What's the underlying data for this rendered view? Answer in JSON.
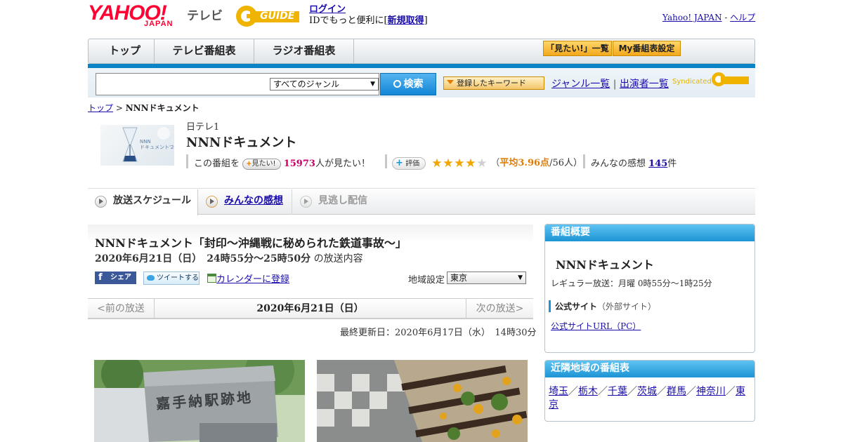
{
  "header": {
    "logo_text": "YAHOO!",
    "logo_sub": "JAPAN",
    "tv_label": "テレビ",
    "gguide_text": "GUIDE",
    "login_link": "ログイン",
    "login_desc": "IDでもっと便利に[",
    "register_link": "新規取得",
    "login_close": "]",
    "yj_link": "Yahoo! JAPAN",
    "sep": " - ",
    "help_link": "ヘルプ"
  },
  "nav": {
    "tabs": [
      "トップ",
      "テレビ番組表",
      "ラジオ番組表"
    ],
    "mitai_list": "「見たい!」一覧",
    "my_bangumi": "My番組表設定"
  },
  "search": {
    "genre_select": "すべてのジャンル",
    "button": "検索",
    "keyword_btn": "登録したキーワード",
    "genre_list": "ジャンル一覧",
    "divider": "|",
    "cast_list": "出演者一覧",
    "syndicated": "Syndicated"
  },
  "breadcrumb": {
    "top": "トップ",
    "sep": " > ",
    "current": "NNNドキュメント"
  },
  "program": {
    "thumb_text": "NNN\nドキュメント'20",
    "channel": "日テレ1",
    "title": "NNNドキュメント",
    "mitai_prefix": "この番組を",
    "mitai_btn": "見たい!",
    "mitai_count": "15973",
    "mitai_suffix": "人が見たい！",
    "rating_btn": "評価",
    "rating_avg_prefix": "（",
    "rating_avg": "平均3.96点",
    "rating_avg_suffix": "/56人）",
    "rating_value": 3.96,
    "impressions_label": "みんなの感想",
    "impressions_count": "145",
    "impressions_suffix": "件"
  },
  "schedule_tabs": [
    "放送スケジュール",
    "みんなの感想",
    "見逃し配信"
  ],
  "episode": {
    "title": "NNNドキュメント「封印～沖縄戦に秘められた鉄道事故～」",
    "date": "2020年6月21日（日）　24時55分～25時50分",
    "date_suffix": "の放送内容",
    "share_btn": "シェア",
    "tweet_btn": "ツイートする",
    "calendar_link": "カレンダーに登録",
    "region_label": "地域設定",
    "region_value": "東京",
    "prev": "<前の放送",
    "next": "次の放送>",
    "pager_date": "2020年6月21日（日）",
    "updated": "最終更新日：2020年6月17日（水）　14時30分",
    "photo1_inscription": "嘉手納駅跡地"
  },
  "sidebar": {
    "overview_head": "番組概要",
    "name": "NNNドキュメント",
    "regular": "レギュラー放送：月曜 0時55分～1時25分",
    "official_site": "公式サイト",
    "official_site_note": "（外部サイト）",
    "official_url": "公式サイトURL（PC）",
    "nearby_head": "近隣地域の番組表",
    "nearby": [
      "埼玉",
      "栃木",
      "千葉",
      "茨城",
      "群馬",
      "神奈川",
      "東京"
    ],
    "nearby_sep": "／"
  },
  "colors": {
    "accent_blue": "#0b84c6",
    "yahoo_red": "#ff0033",
    "mitai_pink": "#cc0066",
    "rating_orange": "#e07b00",
    "star_gold": "#f2a600"
  }
}
